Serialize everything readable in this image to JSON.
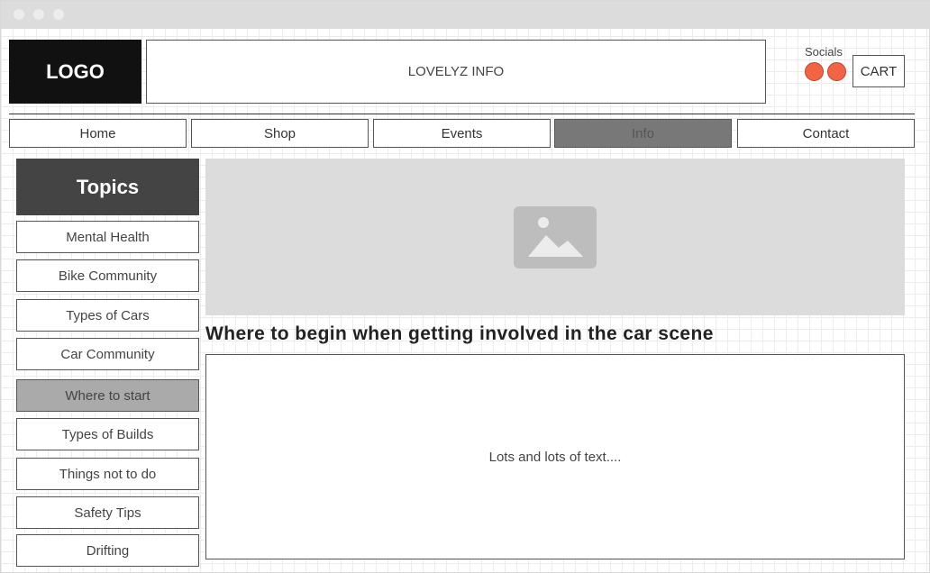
{
  "header": {
    "logo": "LOGO",
    "title": "LOVELYZ INFO",
    "socials_label": "Socials",
    "cart": "CART"
  },
  "nav": {
    "items": [
      {
        "label": "Home"
      },
      {
        "label": "Shop"
      },
      {
        "label": "Events"
      },
      {
        "label": "Info",
        "active": true
      },
      {
        "label": "Contact"
      }
    ]
  },
  "sidebar": {
    "heading": "Topics",
    "items": [
      {
        "label": "Mental Health"
      },
      {
        "label": "Bike Community"
      },
      {
        "label": "Types of Cars"
      },
      {
        "label": "Car Community"
      },
      {
        "label": "Where to start",
        "active": true
      },
      {
        "label": "Types of Builds"
      },
      {
        "label": "Things not to do"
      },
      {
        "label": "Safety Tips"
      },
      {
        "label": "Drifting"
      }
    ]
  },
  "main": {
    "image_icon": "image-placeholder-icon",
    "heading": "Where to begin when getting involved in the car scene",
    "body": "Lots and lots of text...."
  },
  "colors": {
    "social_dot": "#f26444",
    "logo_bg": "#111111",
    "topics_bg": "#444444",
    "active_nav": "#787878",
    "active_topic": "#aaaaaa",
    "image_bg": "#dcdcdc"
  }
}
